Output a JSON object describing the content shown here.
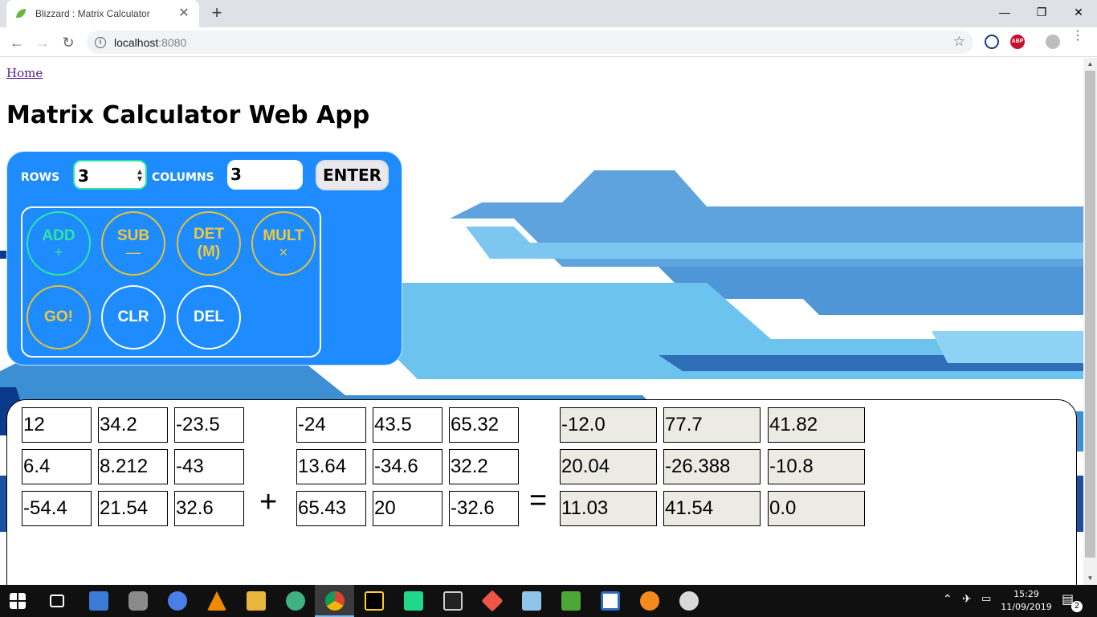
{
  "browser": {
    "tab_title": "Blizzard : Matrix Calculator",
    "tab_close": "✕",
    "new_tab": "+",
    "url_host": "localhost",
    "url_port": ":8080",
    "window_controls": {
      "minimize": "—",
      "restore": "❐",
      "close": "✕"
    },
    "nav": {
      "back": "←",
      "forward": "→",
      "reload": "↻"
    }
  },
  "page": {
    "home_link": "Home",
    "title": "Matrix Calculator Web App"
  },
  "controls": {
    "rows_label": "ROWS",
    "rows_value": "3",
    "columns_label": "COLUMNS",
    "columns_value": "3",
    "enter_label": "ENTER",
    "operations": [
      {
        "label": "ADD",
        "symbol": "+"
      },
      {
        "label": "SUB",
        "symbol": "—"
      },
      {
        "label": "DET",
        "symbol": "(M)"
      },
      {
        "label": "MULT",
        "symbol": "×"
      }
    ],
    "actions": [
      {
        "label": "GO!"
      },
      {
        "label": "CLR"
      },
      {
        "label": "DEL"
      }
    ]
  },
  "matrices": {
    "a": [
      [
        "12",
        "34.2",
        "-23.5"
      ],
      [
        "6.4",
        "8.212",
        "-43"
      ],
      [
        "-54.4",
        "21.54",
        "32.6"
      ]
    ],
    "operator": "+",
    "b": [
      [
        "-24",
        "43.5",
        "65.32"
      ],
      [
        "13.64",
        "-34.6",
        "32.2"
      ],
      [
        "65.43",
        "20",
        "-32.6"
      ]
    ],
    "equals": "=",
    "result": [
      [
        "-12.0",
        "77.7",
        "41.82"
      ],
      [
        "20.04",
        "-26.388",
        "-10.8"
      ],
      [
        "11.03",
        "41.54",
        "0.0"
      ]
    ]
  },
  "taskbar": {
    "time": "15:29",
    "date": "11/09/2019",
    "notifications": "2"
  }
}
